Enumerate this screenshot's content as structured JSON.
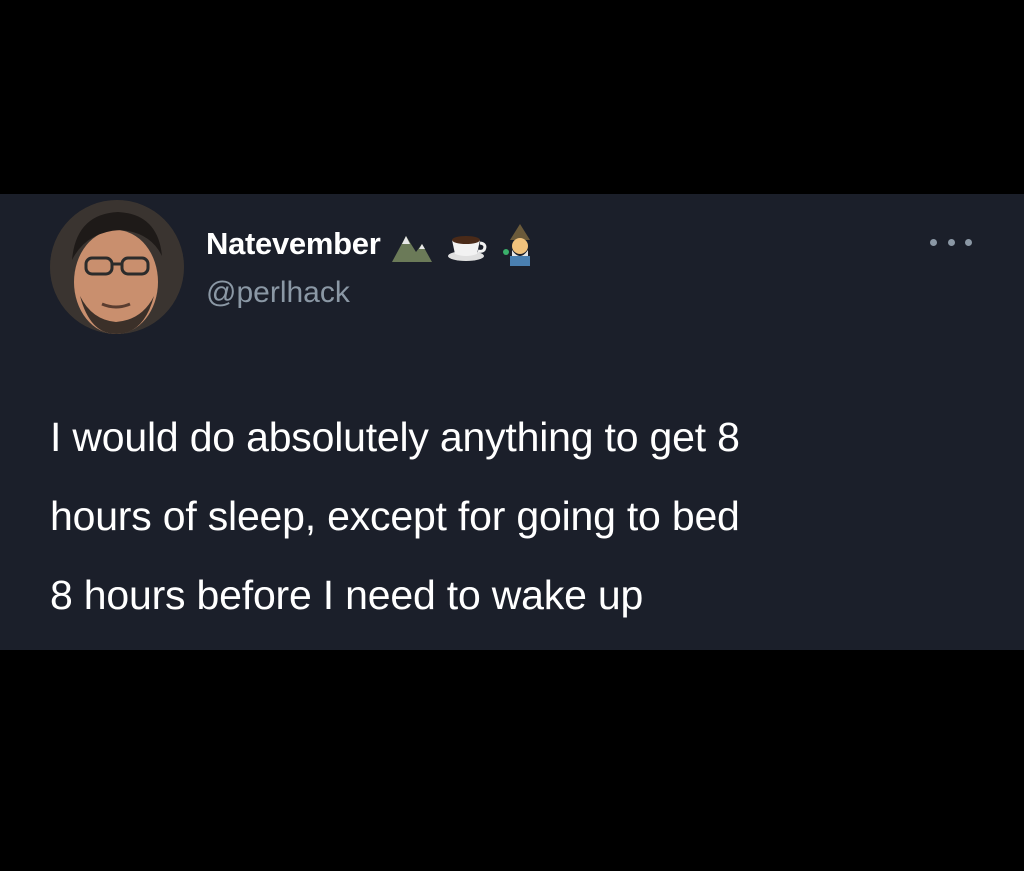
{
  "tweet": {
    "display_name": "Natevember",
    "name_emojis": [
      "mountain-icon",
      "coffee-cup-icon",
      "wizard-icon"
    ],
    "handle": "@perlhack",
    "more_icon": "ellipsis-icon",
    "text_lines": [
      "I would do absolutely anything to get 8",
      "hours of sleep, except for going to bed",
      "8 hours before I need to wake up"
    ]
  },
  "colors": {
    "background": "#000000",
    "card": "#1b1f2a",
    "primary_text": "#ffffff",
    "secondary_text": "#8b98a5"
  }
}
